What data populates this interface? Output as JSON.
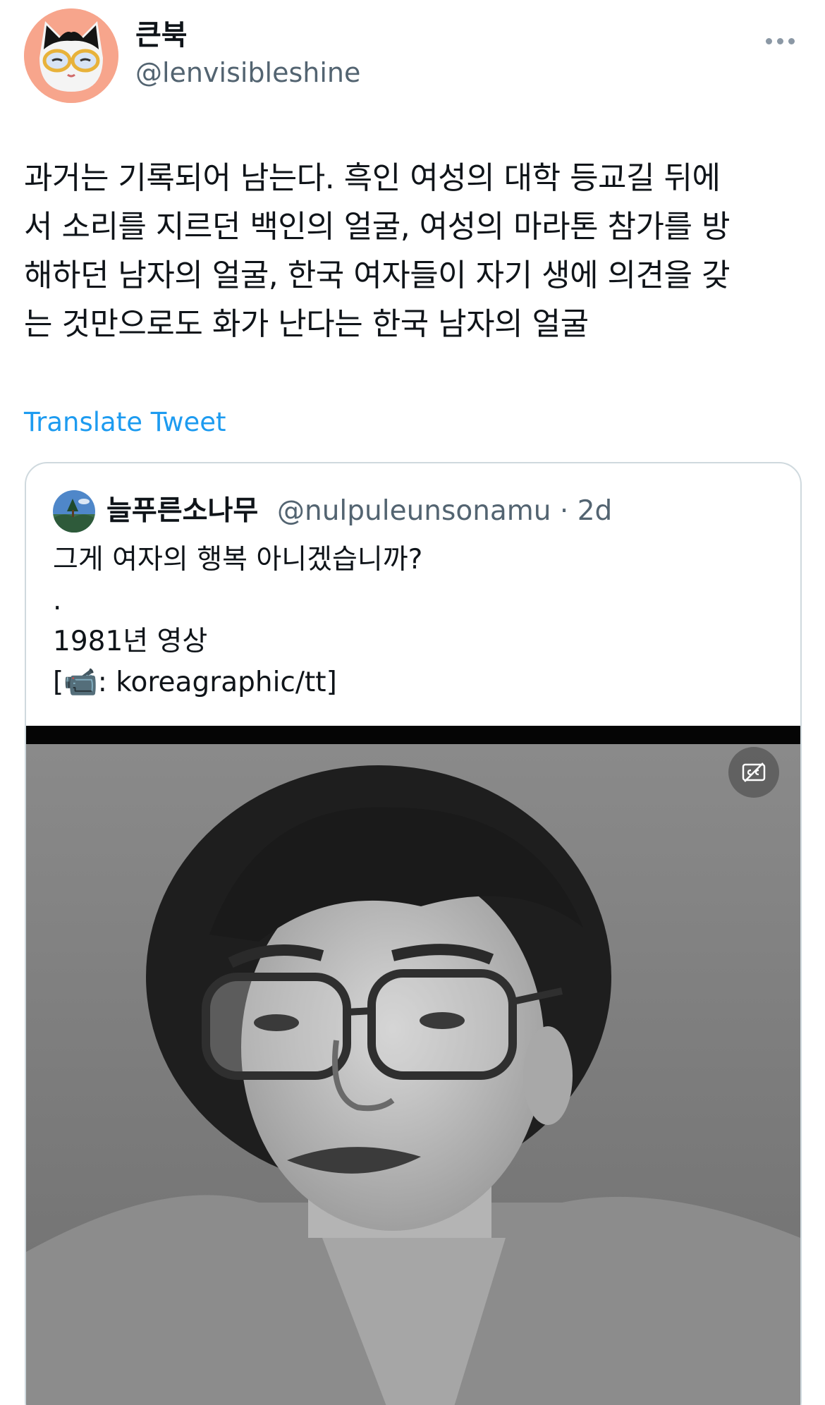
{
  "author": {
    "display_name": "큰북",
    "handle": "@lenvisibleshine",
    "avatar_icon": "cat-avatar-icon"
  },
  "more_icon": "more-horizontal-icon",
  "tweet": {
    "text": "과거는 기록되어 남는다. 흑인 여성의 대학 등교길 뒤에\n서 소리를 지르던 백인의 얼굴, 여성의 마라톤 참가를 방\n해하던 남자의 얼굴, 한국 여자들이 자기 생에 의견을 갖\n는 것만으로도 화가 난다는 한국 남자의 얼굴",
    "translate_label": "Translate Tweet"
  },
  "quoted_tweet": {
    "display_name": "늘푸른소나무",
    "handle_time": "@nulpuleunsonamu · 2d",
    "avatar_icon": "landscape-avatar-icon",
    "text": "그게 여자의 행복 아니겠습니까?\n.\n1981년 영상\n[📹: koreagraphic/tt]",
    "media_icon": "video-thumbnail",
    "caption_toggle_icon": "captions-off-icon"
  },
  "colors": {
    "link": "#1d9bf0",
    "secondary_text": "#536471",
    "border": "#cfd9de"
  }
}
